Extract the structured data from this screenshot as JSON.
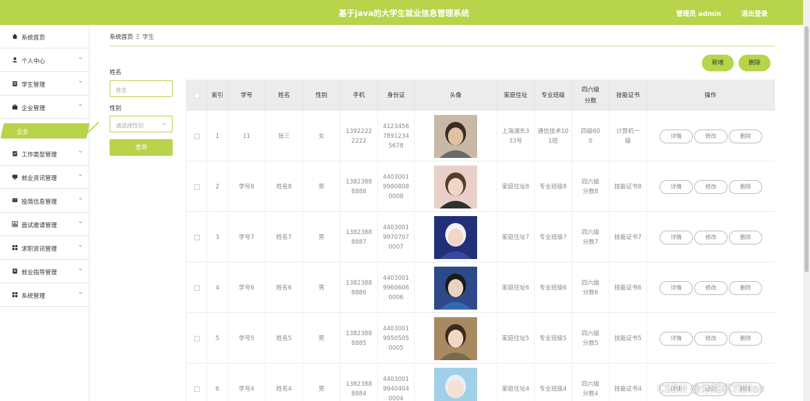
{
  "header": {
    "title": "基于java的大学生就业信息管理系统",
    "admin_label": "管理员 admin",
    "logout_label": "退出登录"
  },
  "sidebar": {
    "items": [
      {
        "label": "系统首页",
        "icon": "home-icon",
        "arrow": false
      },
      {
        "label": "个人中心",
        "icon": "user-icon",
        "arrow": "down"
      },
      {
        "label": "学生管理",
        "icon": "clipboard-icon",
        "arrow": "down"
      },
      {
        "label": "企业管理",
        "icon": "briefcase-icon",
        "arrow": "up"
      },
      {
        "label": "工作类型管理",
        "icon": "clipboard-check-icon",
        "arrow": "down"
      },
      {
        "label": "就业资讯管理",
        "icon": "monitor-icon",
        "arrow": "down"
      },
      {
        "label": "投简信息管理",
        "icon": "chat-icon",
        "arrow": "down"
      },
      {
        "label": "面试邀请管理",
        "icon": "bar-chart-icon",
        "arrow": "down"
      },
      {
        "label": "求职资讯管理",
        "icon": "grid-icon",
        "arrow": "down"
      },
      {
        "label": "就业指导管理",
        "icon": "bookmark-icon",
        "arrow": "down"
      },
      {
        "label": "系统管理",
        "icon": "grid-icon",
        "arrow": "down"
      }
    ],
    "active_sub_item": "企业"
  },
  "breadcrumb": {
    "home": "系统首页",
    "separator": "Ξ",
    "current": "学生"
  },
  "search": {
    "name_label": "姓名",
    "name_placeholder": "姓名",
    "gender_label": "性别",
    "gender_placeholder": "请选择性别",
    "query_button": "查询"
  },
  "actions": {
    "add_button": "新增",
    "delete_button": "删除"
  },
  "table": {
    "columns": [
      "索引",
      "学号",
      "姓名",
      "性别",
      "手机",
      "身份证",
      "头像",
      "家庭住址",
      "专业班级",
      "四六级分数",
      "技能证书",
      "操作"
    ],
    "row_buttons": [
      "详情",
      "修改",
      "删除"
    ],
    "rows": [
      {
        "index": "1",
        "student_no": "11",
        "name": "张三",
        "gender": "女",
        "phone": "13922222222",
        "id_card": "412345678912345678",
        "address": "上海浦东333号",
        "class": "通信技术101班",
        "score": "四级600",
        "certificate": "计算机一级",
        "avatar_colors": [
          "#c9b8a6",
          "#3a2c24",
          "#e0c2a2",
          "#6a6a6a"
        ]
      },
      {
        "index": "2",
        "student_no": "学号8",
        "name": "姓名8",
        "gender": "男",
        "phone": "13823888888",
        "id_card": "440300199808080008",
        "address": "家庭住址8",
        "class": "专业班级8",
        "score": "四六级分数8",
        "certificate": "技能证书8",
        "avatar_colors": [
          "#e8d0c8",
          "#5b3b2a",
          "#f0d6c8",
          "#2f2f2f"
        ]
      },
      {
        "index": "3",
        "student_no": "学号7",
        "name": "姓名7",
        "gender": "男",
        "phone": "13823888887",
        "id_card": "440300199707070007",
        "address": "家庭住址7",
        "class": "专业班级7",
        "score": "四六级分数7",
        "certificate": "技能证书7",
        "avatar_colors": [
          "#22307a",
          "#f2f2f2",
          "#f1d6c8",
          "#3a46a0"
        ]
      },
      {
        "index": "4",
        "student_no": "学号6",
        "name": "姓名6",
        "gender": "男",
        "phone": "13823888886",
        "id_card": "440300199606060006",
        "address": "家庭住址6",
        "class": "专业班级6",
        "score": "四六级分数6",
        "certificate": "技能证书6",
        "avatar_colors": [
          "#2c4a8a",
          "#1a1a1a",
          "#ead2c0",
          "#3567b5"
        ]
      },
      {
        "index": "5",
        "student_no": "学号5",
        "name": "姓名5",
        "gender": "男",
        "phone": "13823888885",
        "id_card": "440300199505050005",
        "address": "家庭住址5",
        "class": "专业班级5",
        "score": "四六级分数5",
        "certificate": "技能证书5",
        "avatar_colors": [
          "#a88a62",
          "#3b2a1e",
          "#f0d8c4",
          "#7a6a4a"
        ]
      },
      {
        "index": "6",
        "student_no": "学号4",
        "name": "姓名4",
        "gender": "男",
        "phone": "13823888884",
        "id_card": "440300199404040004",
        "address": "家庭住址4",
        "class": "专业班级4",
        "score": "四六级分数4",
        "certificate": "技能证书4",
        "avatar_colors": [
          "#9fd0e8",
          "#e8eef4",
          "#f6e0d4",
          "#5aa0c8"
        ]
      }
    ]
  },
  "watermark": "CSDN @沐知机YiDian"
}
